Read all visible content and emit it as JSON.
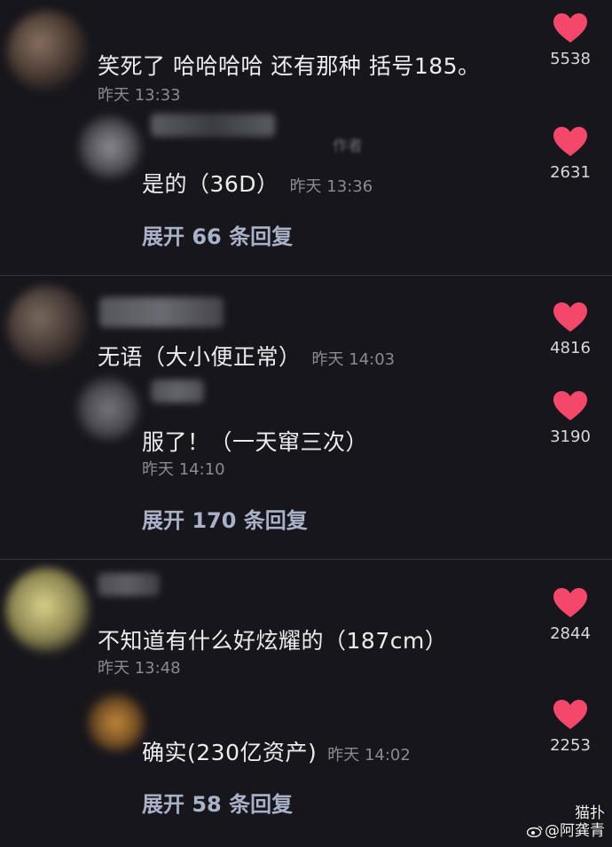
{
  "threads": [
    {
      "comment": {
        "text": "笑死了 哈哈哈哈 还有那种 括号185。",
        "time": "昨天 13:33",
        "likes": "5538"
      },
      "reply": {
        "author_tag": "作者",
        "text": "是的（36D）",
        "time": "昨天 13:36",
        "likes": "2631"
      },
      "expand_label": "展开 66 条回复"
    },
    {
      "comment": {
        "text": "无语（大小便正常）",
        "time": "昨天 14:03",
        "likes": "4816"
      },
      "reply": {
        "text": "服了！（一天窜三次）",
        "time": "昨天 14:10",
        "likes": "3190"
      },
      "expand_label": "展开 170 条回复"
    },
    {
      "comment": {
        "text": "不知道有什么好炫耀的（187cm）",
        "time": "昨天 13:48",
        "likes": "2844"
      },
      "reply": {
        "text": "确实(230亿资产)",
        "time": "昨天 14:02",
        "likes": "2253"
      },
      "expand_label": "展开 58 条回复"
    }
  ],
  "watermark": {
    "line1": "猫扑",
    "line2": "@阿龚青"
  },
  "colors": {
    "background": "#17161c",
    "heart": "#f5476a",
    "expand_link": "#a9b2c6"
  }
}
